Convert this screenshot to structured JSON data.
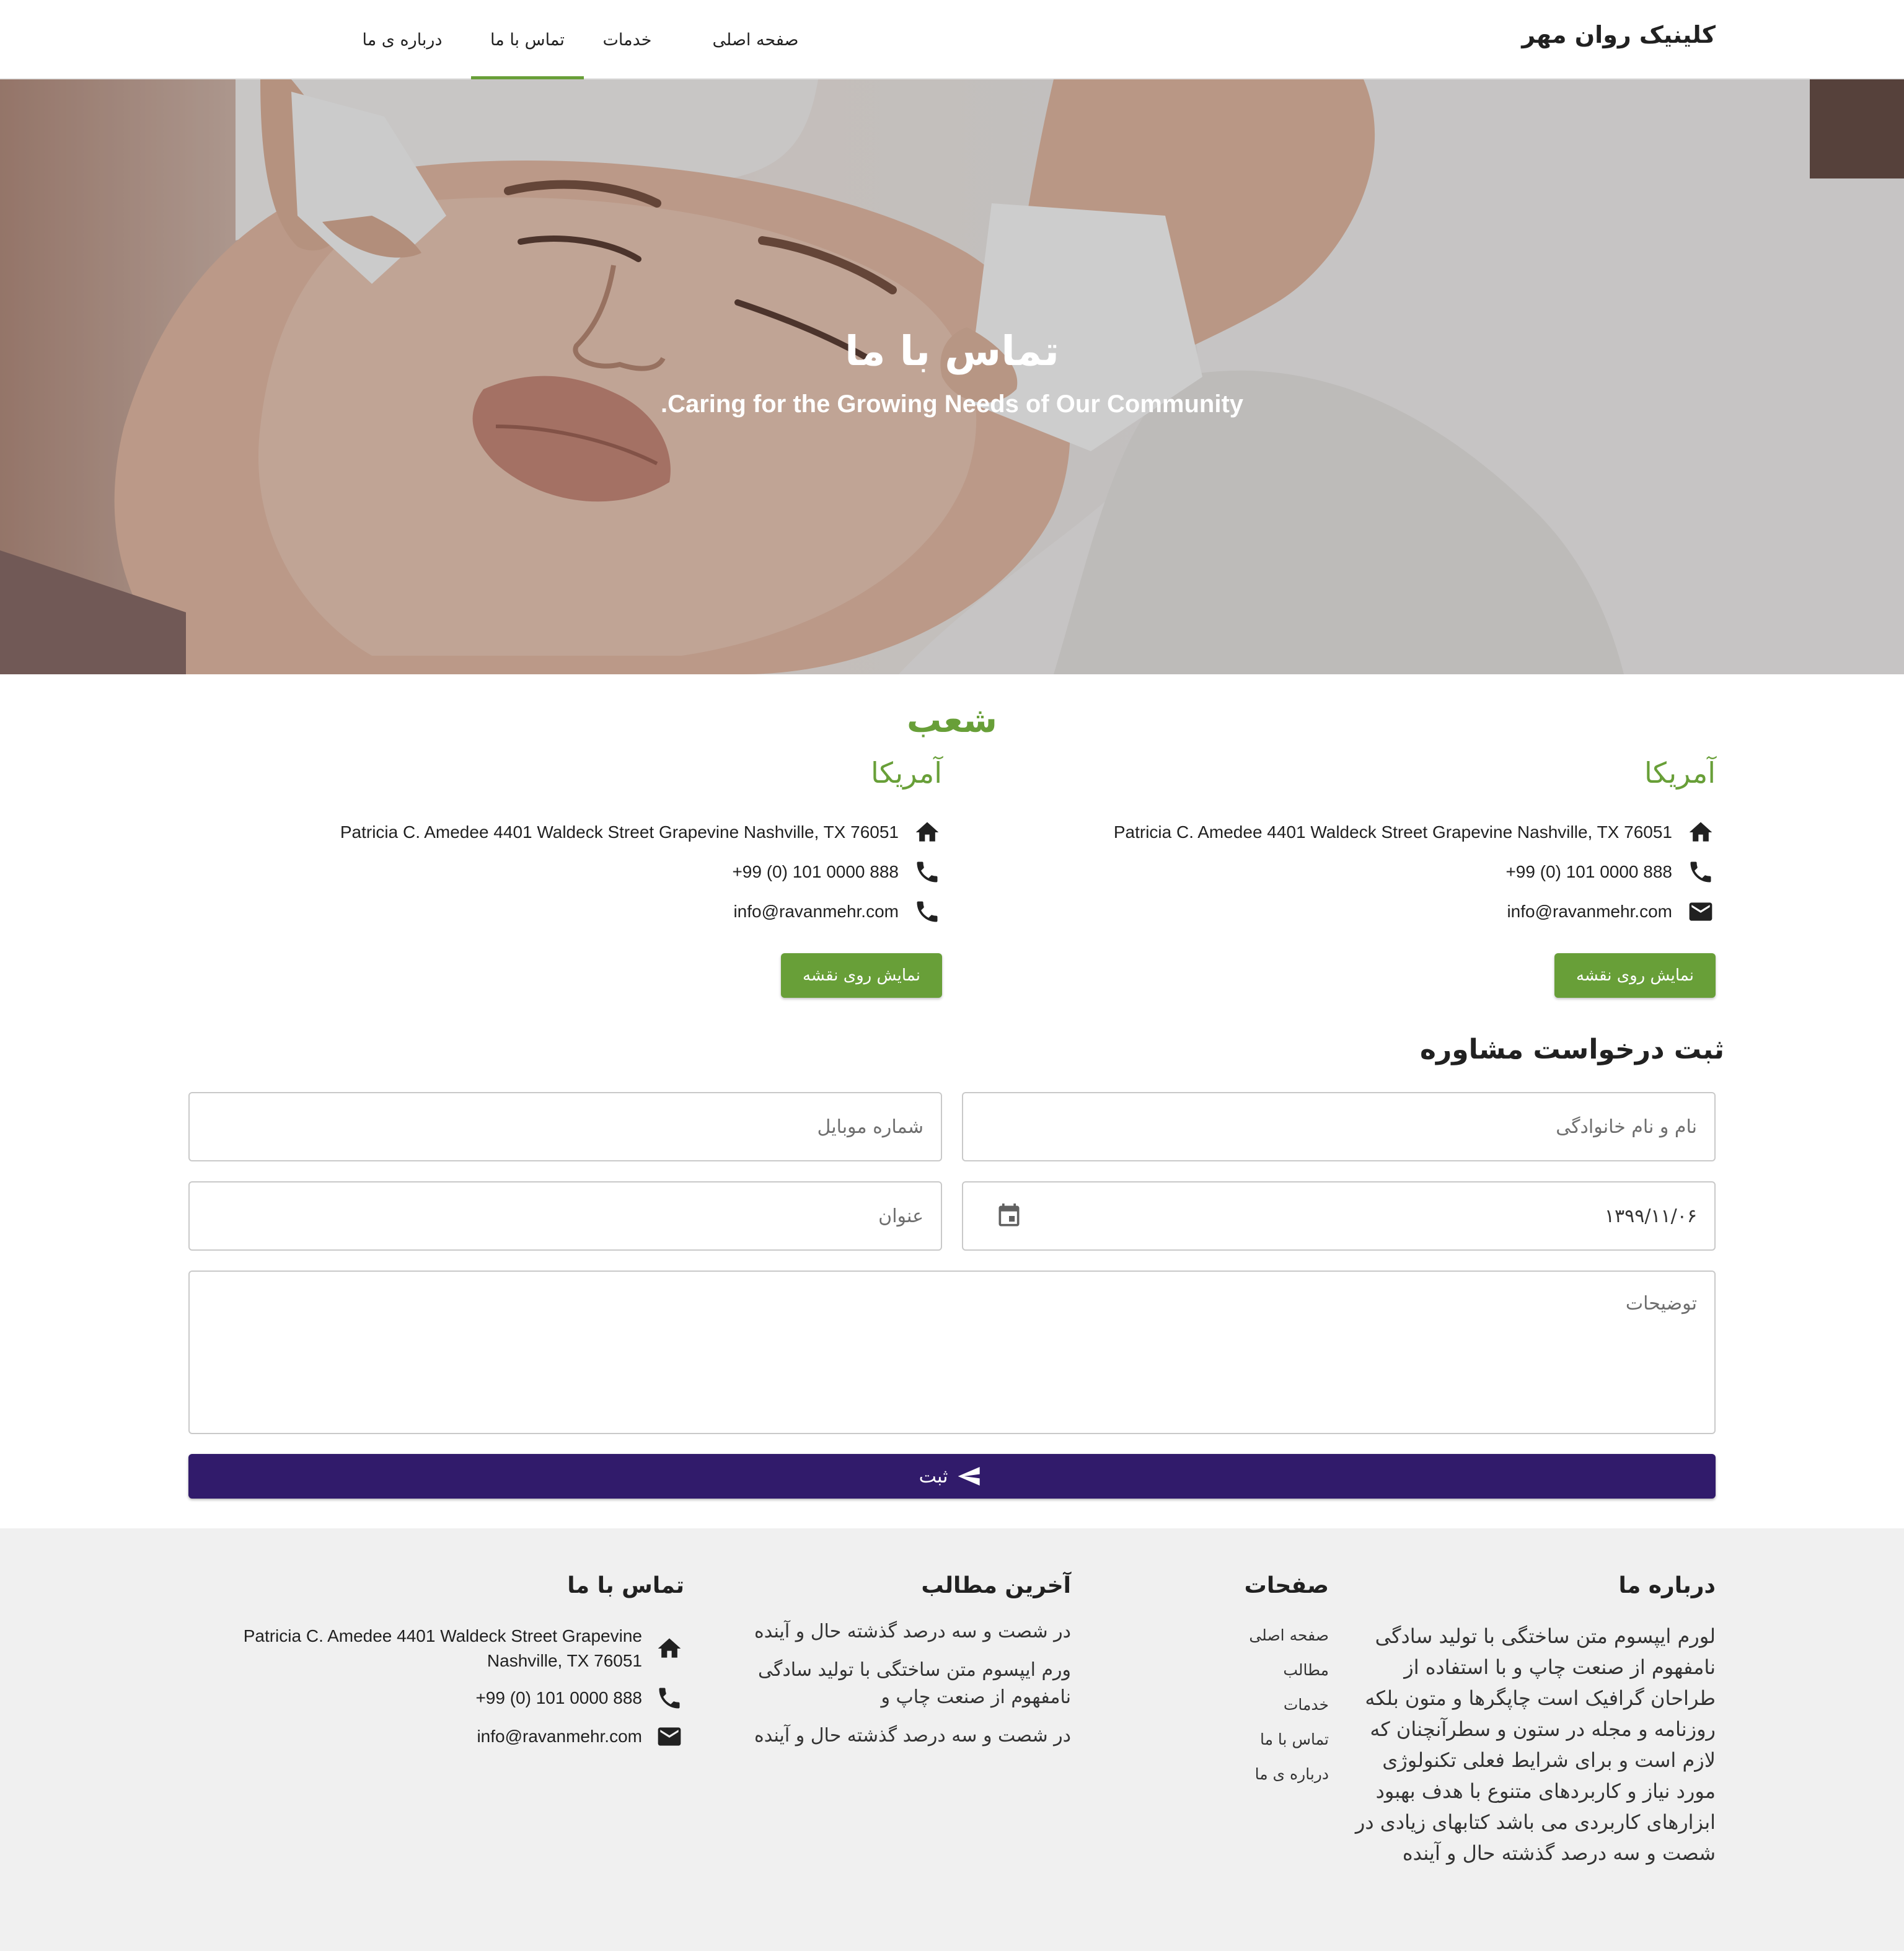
{
  "header": {
    "brand": "کلینیک روان مهر",
    "nav": [
      {
        "label": "صفحه اصلی"
      },
      {
        "label": "خدمات"
      },
      {
        "label": "تماس با ما",
        "active": true
      },
      {
        "label": "درباره ی ما"
      }
    ]
  },
  "hero": {
    "title": "تماس با ما",
    "subtitle": "Caring for the Growing Needs of Our Community."
  },
  "branches": {
    "title": "شعب",
    "items": [
      {
        "name": "آمریکا",
        "address": "Patricia C. Amedee 4401 Waldeck Street Grapevine Nashville, TX 76051",
        "phone": "+99 (0) 101 0000 888",
        "email": "info@ravanmehr.com",
        "email_icon": "email-icon",
        "map_button": "نمایش روی نقشه"
      },
      {
        "name": "آمریکا",
        "address": "Patricia C. Amedee 4401 Waldeck Street Grapevine Nashville, TX 76051",
        "phone": "+99 (0) 101 0000 888",
        "email": "info@ravanmehr.com",
        "email_icon": "phone-icon",
        "map_button": "نمایش روی نقشه"
      }
    ]
  },
  "form": {
    "title": "ثبت درخواست مشاوره",
    "name_placeholder": "نام و نام خانوادگی",
    "mobile_placeholder": "شماره موبایل",
    "date_value": "۱۳۹۹/۱۱/۰۶",
    "subject_placeholder": "عنوان",
    "description_placeholder": "توضیحات",
    "submit_label": "ثبت"
  },
  "footer": {
    "about": {
      "title": "درباره ما",
      "text": "لورم ایپسوم متن ساختگی با تولید سادگی نامفهوم از صنعت چاپ و با استفاده از طراحان گرافیک است چاپگرها و متون بلکه روزنامه و مجله در ستون و سطرآنچنان که لازم است و برای شرایط فعلی تکنولوژی مورد نیاز و کاربردهای متنوع با هدف بهبود ابزارهای کاربردی می باشد کتابهای زیادی در شصت و سه درصد گذشته حال و آینده"
    },
    "pages": {
      "title": "صفحات",
      "links": [
        "صفحه اصلی",
        "مطالب",
        "خدمات",
        "تماس با ما",
        "درباره ی ما"
      ]
    },
    "posts": {
      "title": "آخرین مطالب",
      "items": [
        "در شصت و سه درصد گذشته حال و آینده",
        "ورم ایپسوم متن ساختگی با تولید سادگی نامفهوم از صنعت چاپ و",
        "در شصت و سه درصد گذشته حال و آینده"
      ]
    },
    "contact": {
      "title": "تماس با ما",
      "address": "Patricia C. Amedee 4401 Waldeck Street Grapevine Nashville, TX 76051",
      "phone": "+99 (0) 101 0000 888",
      "email": "info@ravanmehr.com"
    }
  },
  "colors": {
    "accent_green": "#689f38",
    "submit_purple": "#311b6b",
    "footer_bg": "#f0f0f0"
  }
}
